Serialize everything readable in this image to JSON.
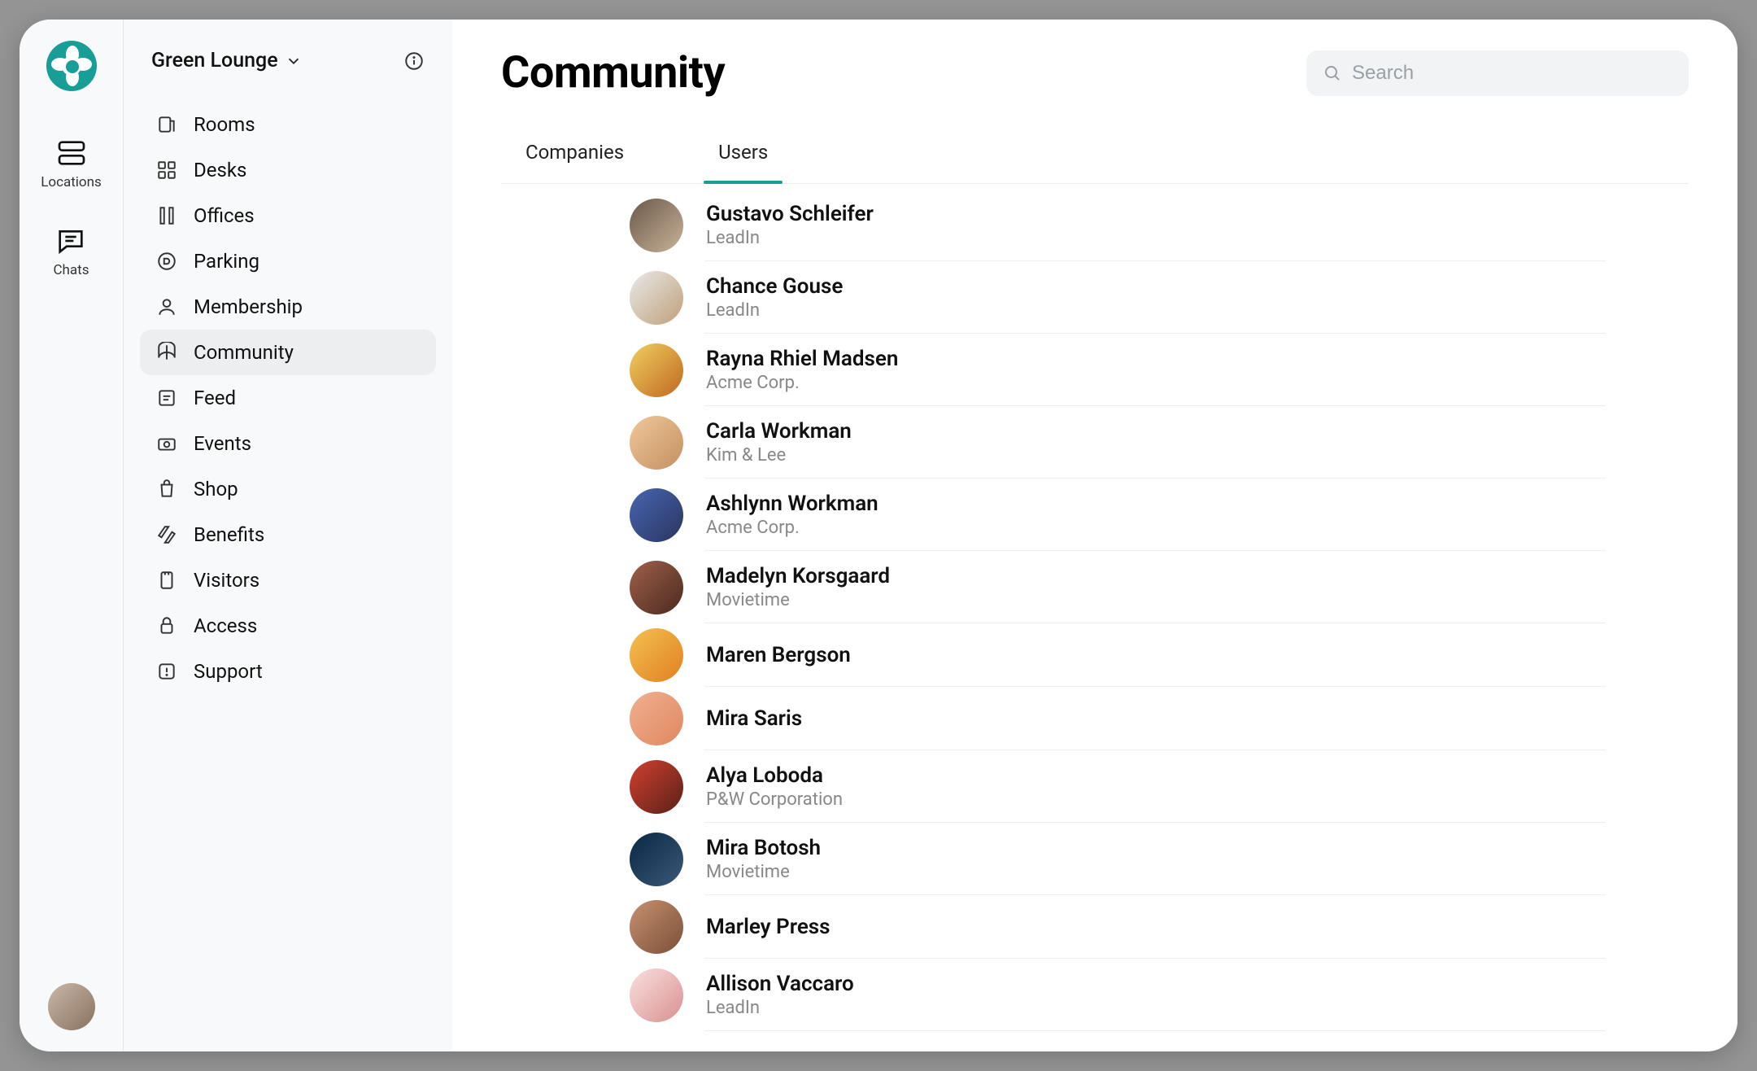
{
  "rail": {
    "locations_label": "Locations",
    "chats_label": "Chats"
  },
  "sidebar": {
    "location_name": "Green Lounge",
    "nav": [
      {
        "label": "Rooms"
      },
      {
        "label": "Desks"
      },
      {
        "label": "Offices"
      },
      {
        "label": "Parking"
      },
      {
        "label": "Membership"
      },
      {
        "label": "Community"
      },
      {
        "label": "Feed"
      },
      {
        "label": "Events"
      },
      {
        "label": "Shop"
      },
      {
        "label": "Benefits"
      },
      {
        "label": "Visitors"
      },
      {
        "label": "Access"
      },
      {
        "label": "Support"
      }
    ],
    "active_index": 5
  },
  "page": {
    "title": "Community"
  },
  "search": {
    "placeholder": "Search"
  },
  "tabs": [
    {
      "label": "Companies"
    },
    {
      "label": "Users"
    }
  ],
  "active_tab": 1,
  "users": [
    {
      "name": "Gustavo Schleifer",
      "company": "LeadIn"
    },
    {
      "name": "Chance Gouse",
      "company": "LeadIn"
    },
    {
      "name": "Rayna Rhiel Madsen",
      "company": "Acme Corp."
    },
    {
      "name": "Carla Workman",
      "company": "Kim & Lee"
    },
    {
      "name": "Ashlynn Workman",
      "company": "Acme Corp."
    },
    {
      "name": "Madelyn Korsgaard",
      "company": "Movietime"
    },
    {
      "name": "Maren Bergson",
      "company": ""
    },
    {
      "name": "Mira Saris",
      "company": ""
    },
    {
      "name": "Alya Loboda",
      "company": "P&W Corporation"
    },
    {
      "name": "Mira Botosh",
      "company": "Movietime"
    },
    {
      "name": "Marley Press",
      "company": ""
    },
    {
      "name": "Allison Vaccaro",
      "company": "LeadIn"
    }
  ]
}
